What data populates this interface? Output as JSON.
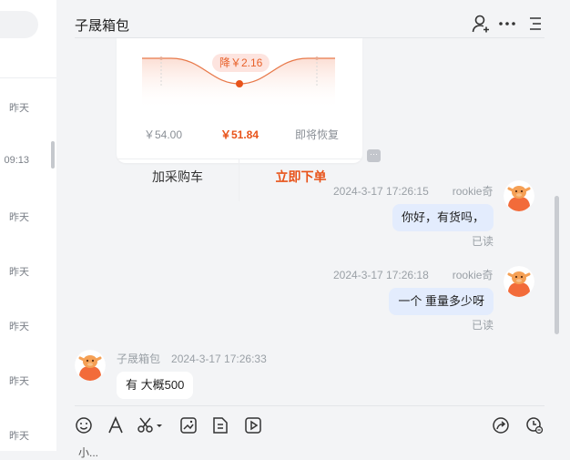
{
  "sidebar": {
    "times": [
      "昨天",
      "09:13",
      "昨天",
      "昨天",
      "昨天",
      "昨天",
      "昨天"
    ]
  },
  "header": {
    "title": "子晟箱包",
    "icons": [
      "add-user-icon",
      "more-icon",
      "menu-icon"
    ]
  },
  "product_card": {
    "drop_badge": "降￥2.16",
    "original_price": "￥54.00",
    "current_price": "￥51.84",
    "restore_label": "即将恢复",
    "add_to_cart": "加采购车",
    "buy_now": "立即下单",
    "accent_color": "#e8531a"
  },
  "messages": [
    {
      "side": "right",
      "timestamp": "2024-3-17 17:26:15",
      "sender": "rookie奇",
      "text": "你好，有货吗，",
      "status": "已读"
    },
    {
      "side": "right",
      "timestamp": "2024-3-17 17:26:18",
      "sender": "rookie奇",
      "text": "一个  重量多少呀",
      "status": "已读"
    },
    {
      "side": "left",
      "timestamp": "2024-3-17 17:26:33",
      "sender": "子晟箱包",
      "text": "有 大概500"
    }
  ],
  "toolbar": {
    "icons": [
      "emoji-icon",
      "font-icon",
      "scissors-icon",
      "image-icon",
      "file-icon",
      "video-icon",
      "share-icon",
      "history-icon"
    ]
  },
  "input": {
    "cut_text": "小..."
  }
}
